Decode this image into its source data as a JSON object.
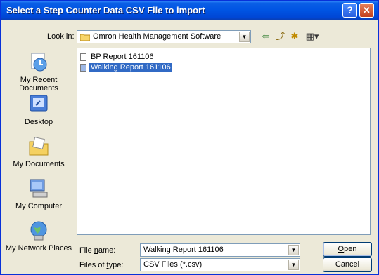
{
  "dialog": {
    "title": "Select a Step Counter Data CSV File to import",
    "help_label": "?",
    "close_label": "✕"
  },
  "lookin": {
    "label": "Look in:",
    "value": "Omron Health Management Software"
  },
  "toolbar": {
    "back_icon": "⇦",
    "up_icon": "⤴",
    "newfolder_icon": "✱",
    "views_icon": "▦▾"
  },
  "places": [
    {
      "label": "My Recent Documents",
      "icon": "recent-documents-icon"
    },
    {
      "label": "Desktop",
      "icon": "desktop-icon"
    },
    {
      "label": "My Documents",
      "icon": "my-documents-icon"
    },
    {
      "label": "My Computer",
      "icon": "my-computer-icon"
    },
    {
      "label": "My Network Places",
      "icon": "network-places-icon"
    }
  ],
  "files": [
    {
      "name": "BP Report 161106",
      "selected": false
    },
    {
      "name": "Walking Report 161106",
      "selected": true
    }
  ],
  "filename": {
    "label_pre": "File ",
    "label_key": "n",
    "label_post": "ame:",
    "value": "Walking Report 161106"
  },
  "filetype": {
    "label_pre": "Files of ",
    "label_key": "t",
    "label_post": "ype:",
    "value": "CSV Files (*.csv)"
  },
  "buttons": {
    "open_key": "O",
    "open_rest": "pen",
    "cancel": "Cancel"
  },
  "colors": {
    "titlebar": "#0054e3",
    "selection": "#316ac5",
    "dialog_bg": "#ece9d8"
  }
}
